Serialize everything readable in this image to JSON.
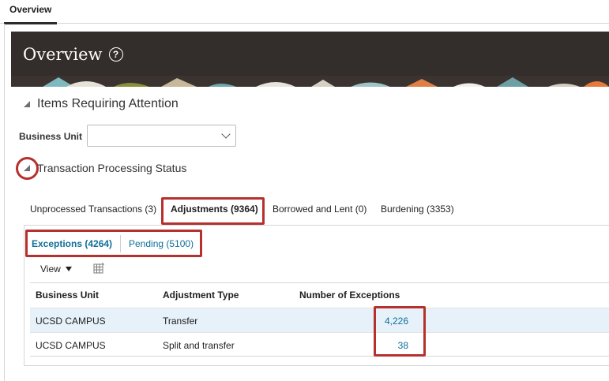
{
  "top_tab": {
    "label": "Overview"
  },
  "banner": {
    "title": "Overview",
    "help_icon": "?"
  },
  "section_items": {
    "label": "Items Requiring Attention"
  },
  "business_unit": {
    "label": "Business Unit",
    "value": ""
  },
  "section_tps": {
    "label": "Transaction Processing Status"
  },
  "tabs": [
    {
      "label": "Unprocessed Transactions (3)"
    },
    {
      "label": "Adjustments (9364)"
    },
    {
      "label": "Borrowed and Lent (0)"
    },
    {
      "label": "Burdening (3353)"
    }
  ],
  "subtabs": [
    {
      "label": "Exceptions (4264)"
    },
    {
      "label": "Pending (5100)"
    }
  ],
  "toolbar": {
    "view_label": "View"
  },
  "table": {
    "headers": [
      "Business Unit",
      "Adjustment Type",
      "Number of Exceptions"
    ],
    "rows": [
      {
        "business_unit": "UCSD CAMPUS",
        "adjustment_type": "Transfer",
        "exceptions": "4,226"
      },
      {
        "business_unit": "UCSD CAMPUS",
        "adjustment_type": "Split and transfer",
        "exceptions": "38"
      }
    ]
  },
  "colors": {
    "banner_bg": "#332e2b",
    "highlight": "#b5312e",
    "link": "#0f6f9a",
    "selected_row": "#e6f1f9"
  }
}
